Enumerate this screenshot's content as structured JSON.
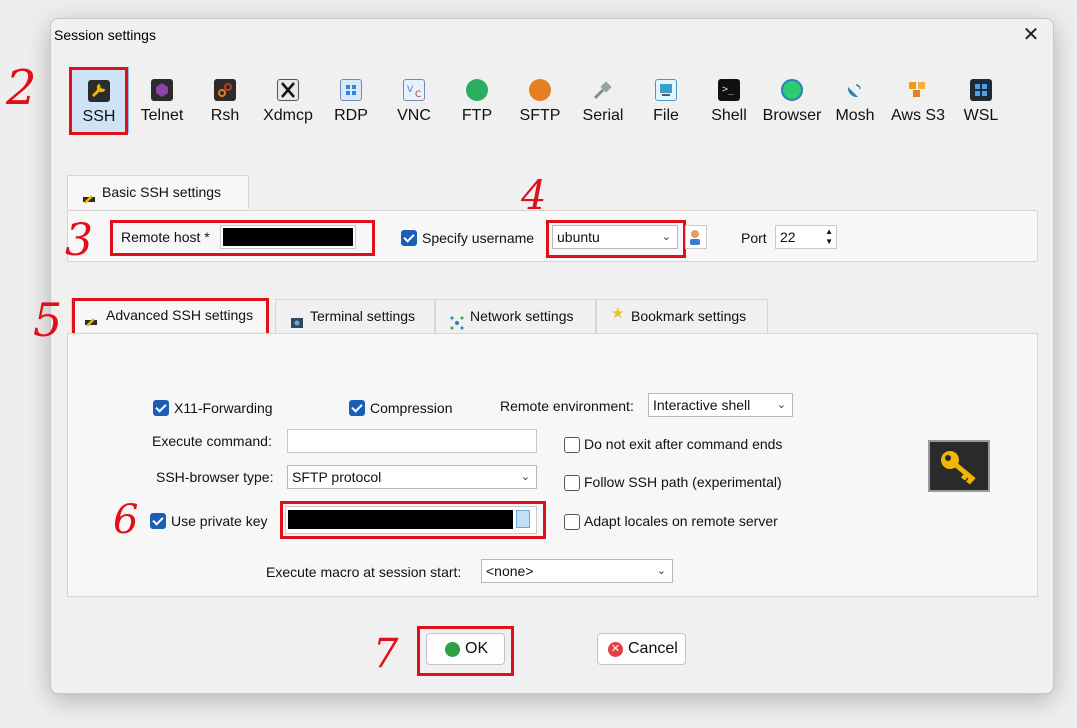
{
  "window": {
    "title": "Session settings",
    "close_glyph": "✕"
  },
  "session_types": [
    {
      "label": "SSH",
      "icon": "ssh-wrench-icon",
      "color": "#f2b705"
    },
    {
      "label": "Telnet",
      "icon": "telnet-icon",
      "color": "#8e44ad"
    },
    {
      "label": "Rsh",
      "icon": "rsh-icon",
      "color": "#c0392b"
    },
    {
      "label": "Xdmcp",
      "icon": "xdmcp-icon",
      "color": "#555555"
    },
    {
      "label": "RDP",
      "icon": "rdp-icon",
      "color": "#2e86de"
    },
    {
      "label": "VNC",
      "icon": "vnc-icon",
      "color": "#3b7dd8"
    },
    {
      "label": "FTP",
      "icon": "ftp-icon",
      "color": "#27ae60"
    },
    {
      "label": "SFTP",
      "icon": "sftp-icon",
      "color": "#e67e22"
    },
    {
      "label": "Serial",
      "icon": "serial-icon",
      "color": "#7f8c8d"
    },
    {
      "label": "File",
      "icon": "file-icon",
      "color": "#3aa0c8"
    },
    {
      "label": "Shell",
      "icon": "shell-icon",
      "color": "#222222"
    },
    {
      "label": "Browser",
      "icon": "browser-globe-icon",
      "color": "#2ecc71"
    },
    {
      "label": "Mosh",
      "icon": "mosh-satellite-icon",
      "color": "#2980b9"
    },
    {
      "label": "Aws S3",
      "icon": "aws-s3-icon",
      "color": "#f39c12"
    },
    {
      "label": "WSL",
      "icon": "wsl-windows-icon",
      "color": "#1e6fd9"
    }
  ],
  "basic": {
    "tab_label": "Basic SSH settings",
    "remote_host_label": "Remote host *",
    "specify_username_label": "Specify username",
    "specify_username_checked": true,
    "username": "ubuntu",
    "port_label": "Port",
    "port": "22"
  },
  "adv_tabs": [
    {
      "label": "Advanced SSH settings",
      "icon": "wrench-icon"
    },
    {
      "label": "Terminal settings",
      "icon": "terminal-icon"
    },
    {
      "label": "Network settings",
      "icon": "network-icon"
    },
    {
      "label": "Bookmark settings",
      "icon": "star-icon"
    }
  ],
  "advanced": {
    "x11_label": "X11-Forwarding",
    "x11_checked": true,
    "compression_label": "Compression",
    "compression_checked": true,
    "remote_env_label": "Remote environment:",
    "remote_env_value": "Interactive shell",
    "exec_cmd_label": "Execute command:",
    "exec_cmd_value": "",
    "no_exit_label": "Do not exit after command ends",
    "no_exit_checked": false,
    "browser_type_label": "SSH-browser type:",
    "browser_type_value": "SFTP protocol",
    "follow_path_label": "Follow SSH path (experimental)",
    "follow_path_checked": false,
    "private_key_label": "Use private key",
    "private_key_checked": true,
    "adapt_locales_label": "Adapt locales on remote server",
    "adapt_locales_checked": false,
    "macro_label": "Execute macro at session start:",
    "macro_value": "<none>"
  },
  "buttons": {
    "ok": "OK",
    "cancel": "Cancel"
  },
  "annotations": [
    "2",
    "3",
    "4",
    "5",
    "6",
    "7"
  ],
  "colors": {
    "accent": "#1a5fb4",
    "highlight_box": "#e0101a",
    "selected_bg": "#cfe3f7"
  }
}
